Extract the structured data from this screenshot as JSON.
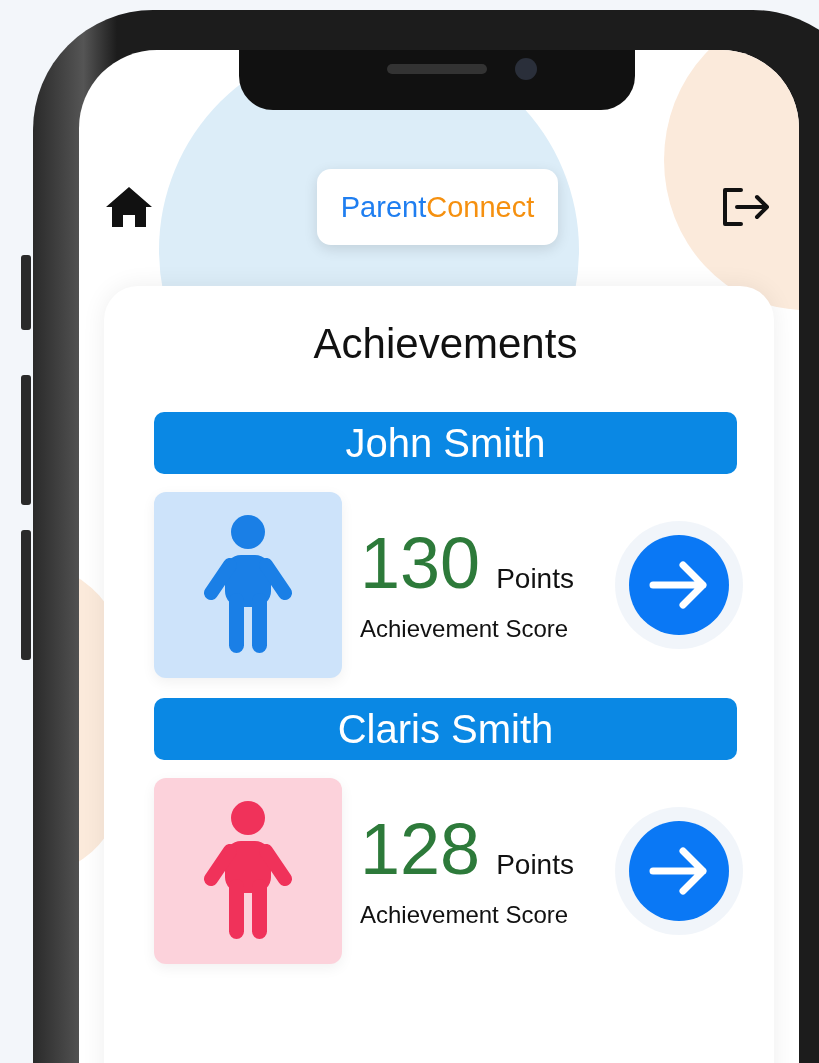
{
  "header": {
    "brand": {
      "first": "Parent",
      "second": "Connect"
    }
  },
  "card": {
    "title": "Achievements",
    "children": [
      {
        "name": "John Smith",
        "score": "130",
        "unit": "Points",
        "caption": "Achievement Score",
        "color": "#1a7fe6"
      },
      {
        "name": "Claris Smith",
        "score": "128",
        "unit": "Points",
        "caption": "Achievement Score",
        "color": "#f0325a"
      }
    ]
  }
}
